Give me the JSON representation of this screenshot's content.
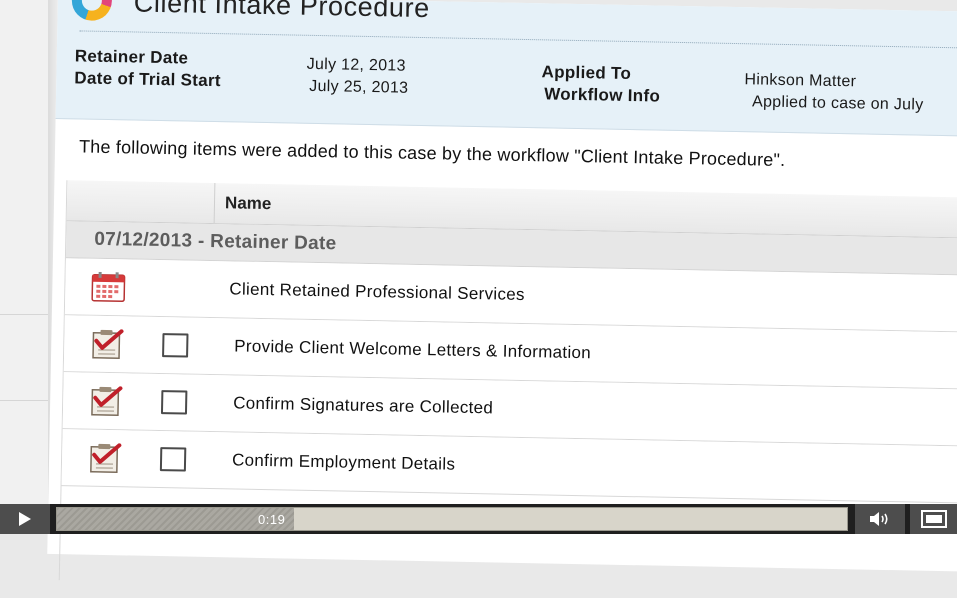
{
  "page": {
    "title": "Client Intake Procedure",
    "meta": {
      "retainer_date_label": "Retainer Date",
      "retainer_date_value": "July 12, 2013",
      "trial_start_label": "Date of Trial Start",
      "trial_start_value": "July 25, 2013",
      "applied_to_label": "Applied To",
      "applied_to_value": "Hinkson Matter",
      "workflow_info_label": "Workflow Info",
      "workflow_info_value": "Applied to case on July"
    },
    "intro": "The following items were added to this case by the workflow \"Client Intake Procedure\"."
  },
  "table": {
    "header_name": "Name",
    "group": "07/12/2013 - Retainer Date",
    "rows": [
      {
        "type": "event",
        "icon": "calendar-icon",
        "label": "Client Retained Professional Services"
      },
      {
        "type": "task",
        "icon": "task-checklist-icon",
        "label": "Provide Client Welcome Letters & Information",
        "checked": false
      },
      {
        "type": "task",
        "icon": "task-checklist-icon",
        "label": "Confirm Signatures are Collected",
        "checked": false
      },
      {
        "type": "task",
        "icon": "task-checklist-icon",
        "label": "Confirm Employment Details",
        "checked": false
      }
    ]
  },
  "player": {
    "time": "0:19",
    "progress": 0.3,
    "icons": [
      "play-icon",
      "volume-icon",
      "fullscreen-icon"
    ]
  },
  "colors": {
    "header_bg": "#e6f1f8",
    "group_text": "#5d5d5d",
    "task_check": "#c0202a",
    "controls_bg": "#4d4d4d"
  }
}
